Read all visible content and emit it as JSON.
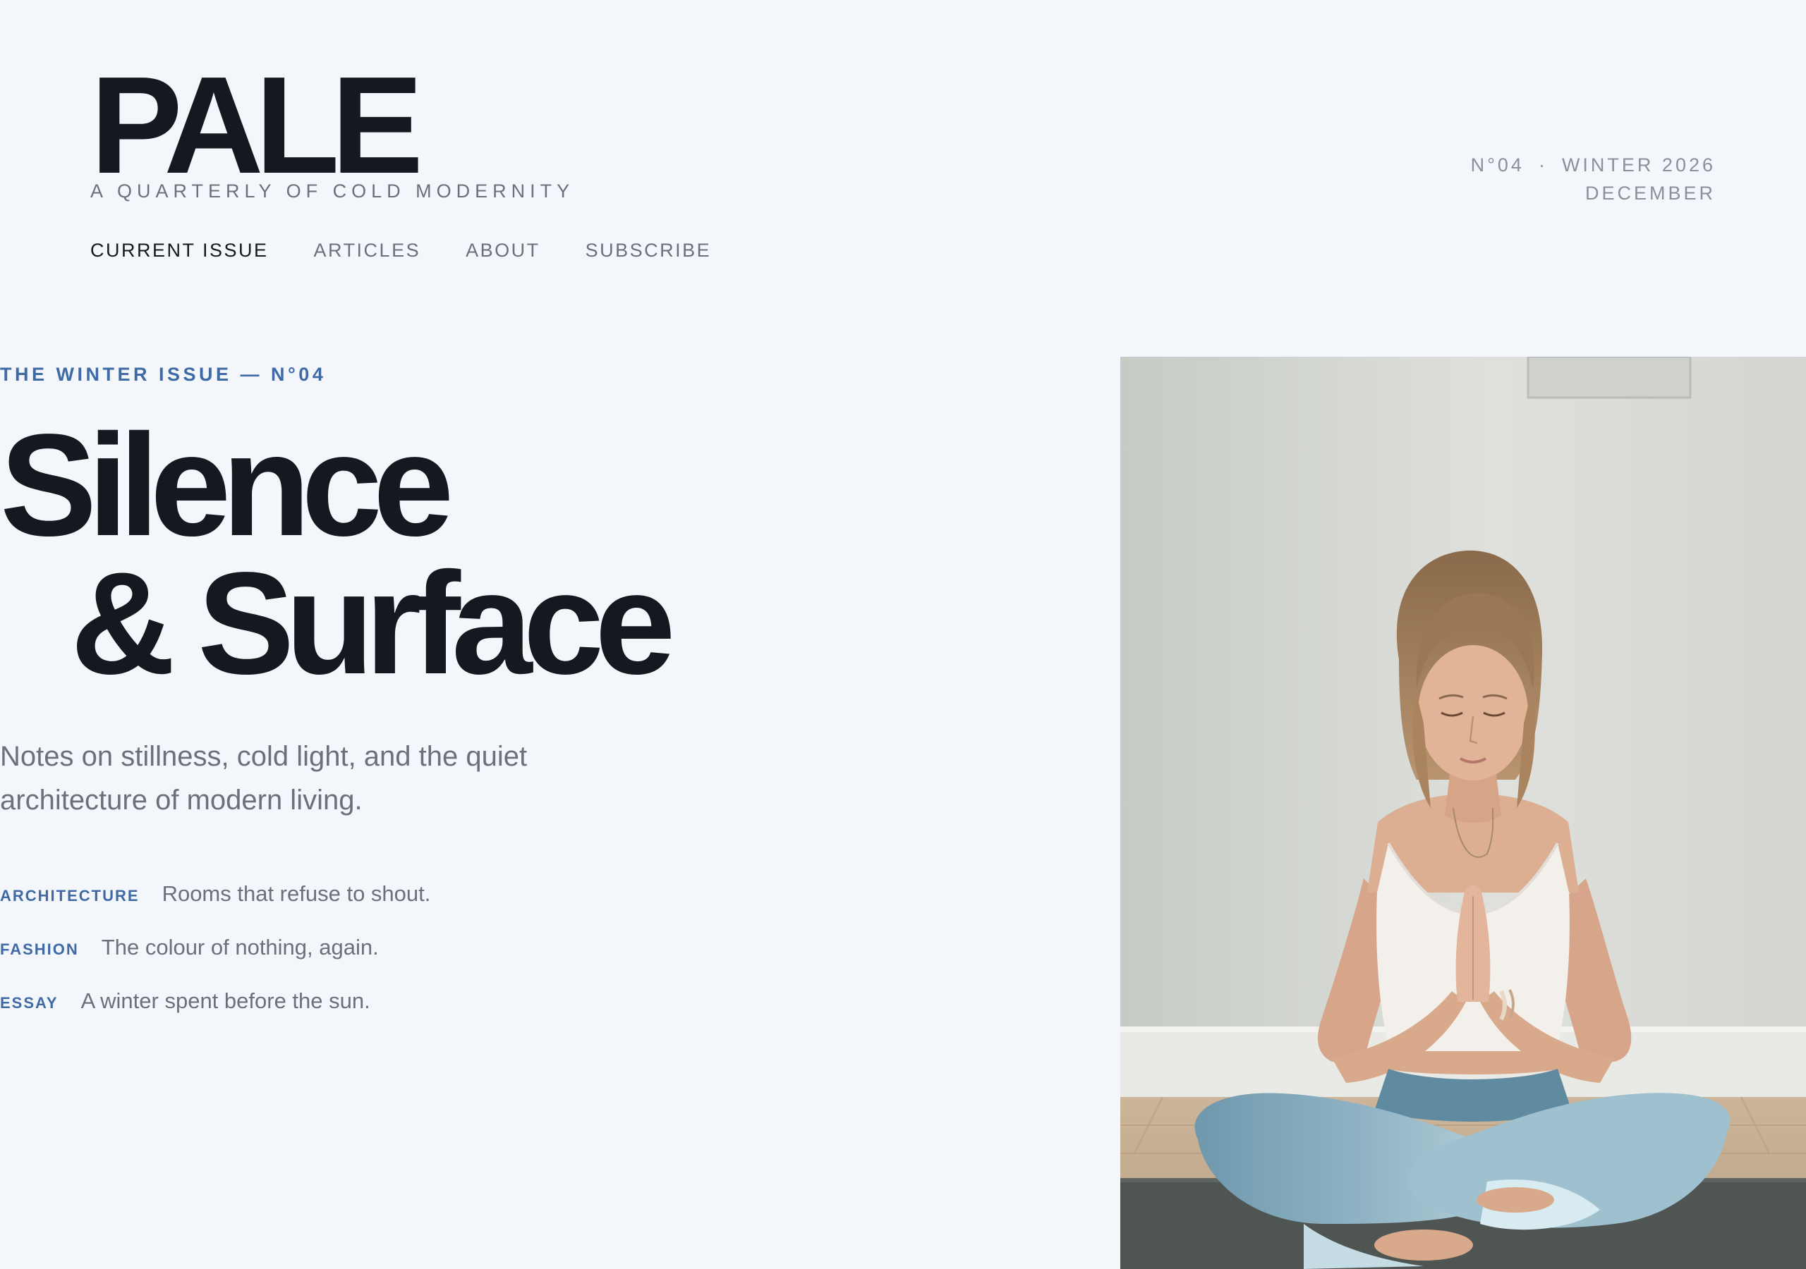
{
  "header": {
    "brand": "PALE",
    "tagline": "A QUARTERLY OF COLD MODERNITY",
    "issue_number": "N°04",
    "issue_season": "WINTER 2026",
    "issue_month": "DECEMBER",
    "separator": "·"
  },
  "nav": {
    "items": [
      {
        "label": "CURRENT ISSUE"
      },
      {
        "label": "ARTICLES"
      },
      {
        "label": "ABOUT"
      },
      {
        "label": "SUBSCRIBE"
      }
    ],
    "active_index": 0
  },
  "hero": {
    "kicker": "THE WINTER ISSUE — N°04",
    "headline_line1": "Silence",
    "headline_line2": "& Surface",
    "deck": "Notes on stillness, cold light, and the quiet architecture of modern living.",
    "image_subject": "woman-meditating-photo"
  },
  "contents": [
    {
      "category": "ARCHITECTURE",
      "title": "Rooms that refuse to shout."
    },
    {
      "category": "FASHION",
      "title": "The colour of nothing, again."
    },
    {
      "category": "ESSAY",
      "title": "A winter spent before the sun."
    }
  ],
  "colors": {
    "background": "#f3f6fa",
    "ink": "#15181e",
    "muted": "#6a717b",
    "accent": "#3f6aa6"
  }
}
